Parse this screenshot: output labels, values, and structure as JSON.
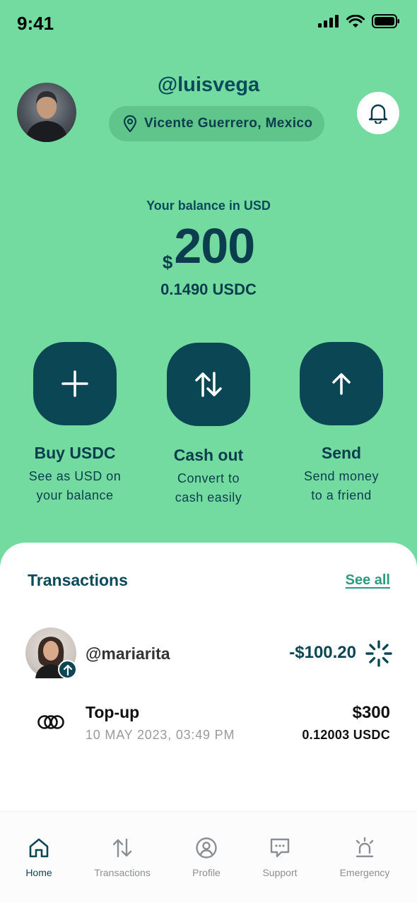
{
  "status_bar": {
    "time": "9:41"
  },
  "profile": {
    "username": "@luisvega",
    "location": "Vicente Guerrero, Mexico"
  },
  "balance": {
    "caption": "Your balance in USD",
    "currency_symbol": "$",
    "amount": "200",
    "usdc": "0.1490 USDC"
  },
  "actions": [
    {
      "title": "Buy USDC",
      "desc1": "See as USD on",
      "desc2": "your balance",
      "icon": "plus-icon"
    },
    {
      "title": "Cash out",
      "desc1": "Convert to",
      "desc2": "cash easily",
      "icon": "swap-arrows-icon"
    },
    {
      "title": "Send",
      "desc1": "Send money",
      "desc2": "to a friend",
      "icon": "arrow-up-icon"
    }
  ],
  "transactions": {
    "heading": "Transactions",
    "see_all": "See all",
    "items": [
      {
        "name": "@mariarita",
        "amount": "-$100.20",
        "status": "pending-spinner-icon"
      },
      {
        "title": "Top-up",
        "date": "10 MAY 2023, 03:49 PM",
        "amount": "$300",
        "sub": "0.12003 USDC"
      }
    ]
  },
  "tabs": [
    {
      "label": "Home",
      "icon": "home-icon",
      "active": true
    },
    {
      "label": "Transactions",
      "icon": "transactions-icon",
      "active": false
    },
    {
      "label": "Profile",
      "icon": "profile-icon",
      "active": false
    },
    {
      "label": "Support",
      "icon": "chat-icon",
      "active": false
    },
    {
      "label": "Emergency",
      "icon": "siren-icon",
      "active": false
    }
  ],
  "colors": {
    "background": "#73db9f",
    "primary": "#0b4655",
    "link": "#2a9c7d"
  }
}
